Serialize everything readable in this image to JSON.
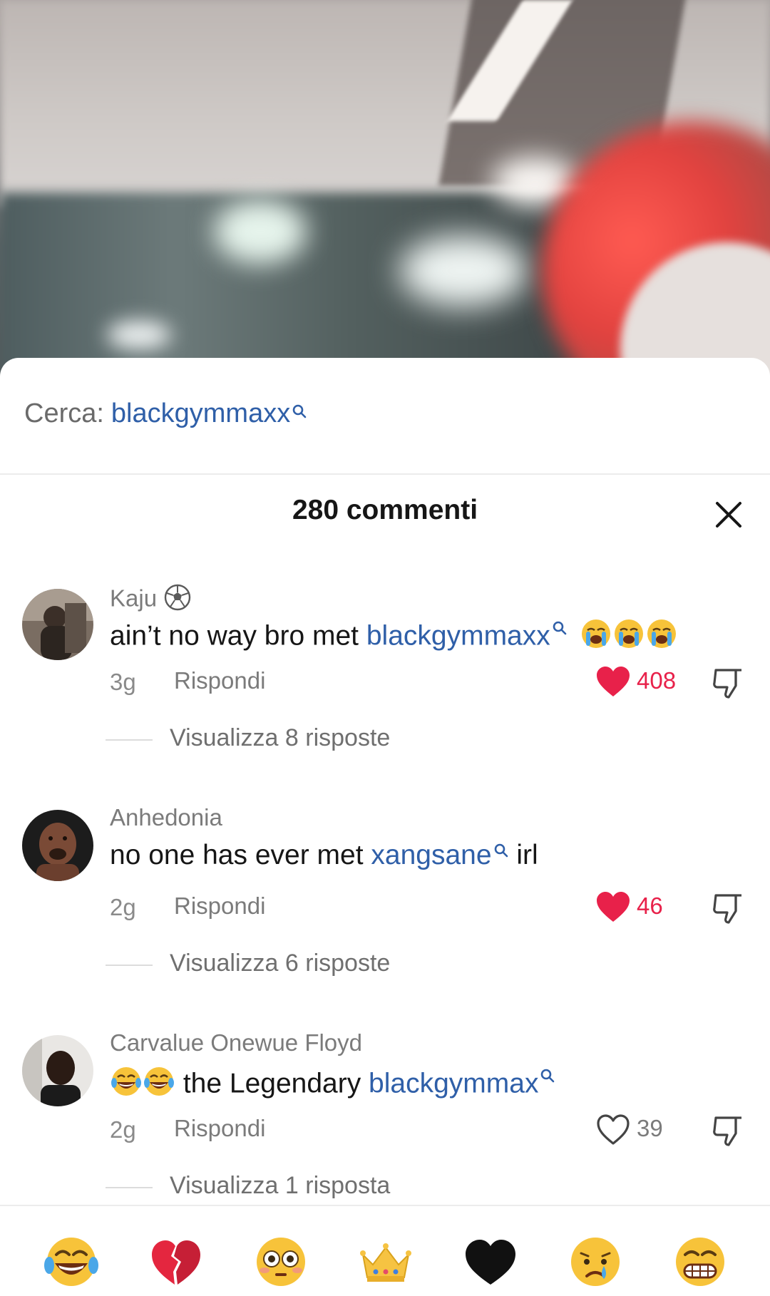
{
  "search": {
    "prefix": "Cerca:",
    "term": "blackgymmaxx"
  },
  "header": {
    "title": "280 commenti"
  },
  "comments": [
    {
      "username": "Kaju",
      "username_emoji": "soccer-ball",
      "text_before": "ain’t no way bro met ",
      "mention": "blackgymmaxx",
      "text_after": "",
      "trailing_emojis": [
        "loudly-crying-face",
        "loudly-crying-face",
        "loudly-crying-face"
      ],
      "time": "3g",
      "reply_label": "Rispondi",
      "likes": "408",
      "liked": true,
      "view_replies": "Visualizza 8 risposte"
    },
    {
      "username": "Anhedonia",
      "text_before": "no one has ever met ",
      "mention": "xangsane",
      "text_after": " irl",
      "time": "2g",
      "reply_label": "Rispondi",
      "likes": "46",
      "liked": true,
      "view_replies": "Visualizza 6 risposte"
    },
    {
      "username": "Carvalue Onewue Floyd",
      "leading_emojis": [
        "tears-of-joy-face",
        "tears-of-joy-face"
      ],
      "text_before": " the Legendary ",
      "mention": "blackgymmax",
      "text_after": "",
      "time": "2g",
      "reply_label": "Rispondi",
      "likes": "39",
      "liked": false,
      "view_replies": "Visualizza 1 risposta"
    }
  ],
  "emoji_bar": [
    "tears-of-joy-face",
    "broken-heart",
    "flushed-face",
    "crown",
    "black-heart",
    "crying-face",
    "grinning-face"
  ],
  "colors": {
    "mention_blue": "#2f5fa8",
    "like_red": "#e8214a",
    "muted_gray": "#7b7b7b"
  }
}
